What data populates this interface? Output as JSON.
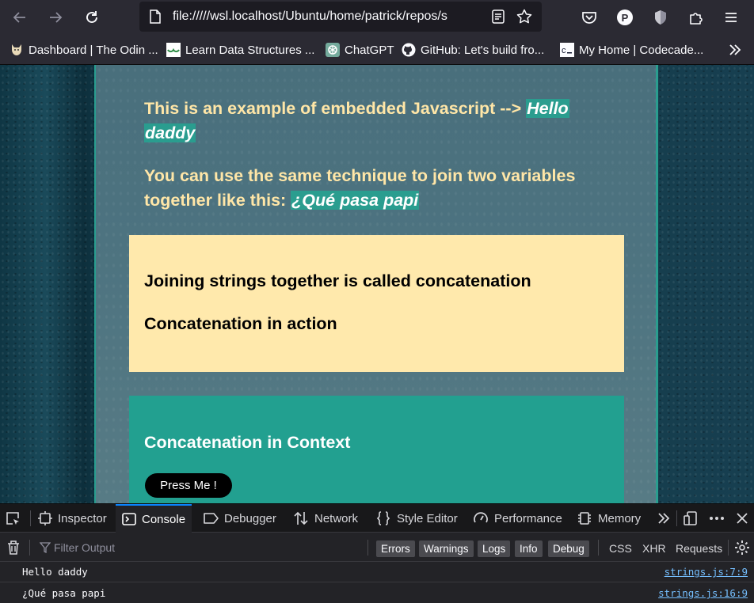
{
  "browser": {
    "url": "file://///wsl.localhost/Ubuntu/home/patrick/repos/s",
    "profile_initial": "P"
  },
  "bookmarks": [
    {
      "label": "Dashboard | The Odin ..."
    },
    {
      "label": "Learn Data Structures ..."
    },
    {
      "label": "ChatGPT"
    },
    {
      "label": "GitHub: Let's build fro..."
    },
    {
      "label": "My Home | Codecade..."
    }
  ],
  "content": {
    "line1_prefix": "This is an example of embedded Javascript --> ",
    "line1_value": "Hello",
    "line1_value_2": "daddy",
    "line2_prefix_a": "You can use the same technique to join two variables",
    "line2_prefix_b": "together like this: ",
    "line2_value": "¿Qué pasa papi",
    "card1_heading1": "Joining strings together is called concatenation",
    "card1_heading2": "Concatenation in action",
    "card2_heading": "Concatenation in Context",
    "button_label": "Press Me !"
  },
  "devtools": {
    "tabs": [
      {
        "label": "Inspector"
      },
      {
        "label": "Console"
      },
      {
        "label": "Debugger"
      },
      {
        "label": "Network"
      },
      {
        "label": "Style Editor"
      },
      {
        "label": "Performance"
      },
      {
        "label": "Memory"
      }
    ],
    "active_tab": "Console",
    "filter_placeholder": "Filter Output",
    "level_filters": [
      "Errors",
      "Warnings",
      "Logs",
      "Info",
      "Debug"
    ],
    "type_filters": [
      "CSS",
      "XHR",
      "Requests"
    ],
    "logs": [
      {
        "message": "Hello daddy",
        "source": "strings.js:7:9"
      },
      {
        "message": "¿Qué pasa papi",
        "source": "strings.js:16:9"
      }
    ]
  },
  "colors": {
    "accent_teal": "#2a9d8f",
    "cream_text": "#ffe6a7",
    "card_yellow": "#ffe9ac",
    "card_teal": "#22a090"
  }
}
